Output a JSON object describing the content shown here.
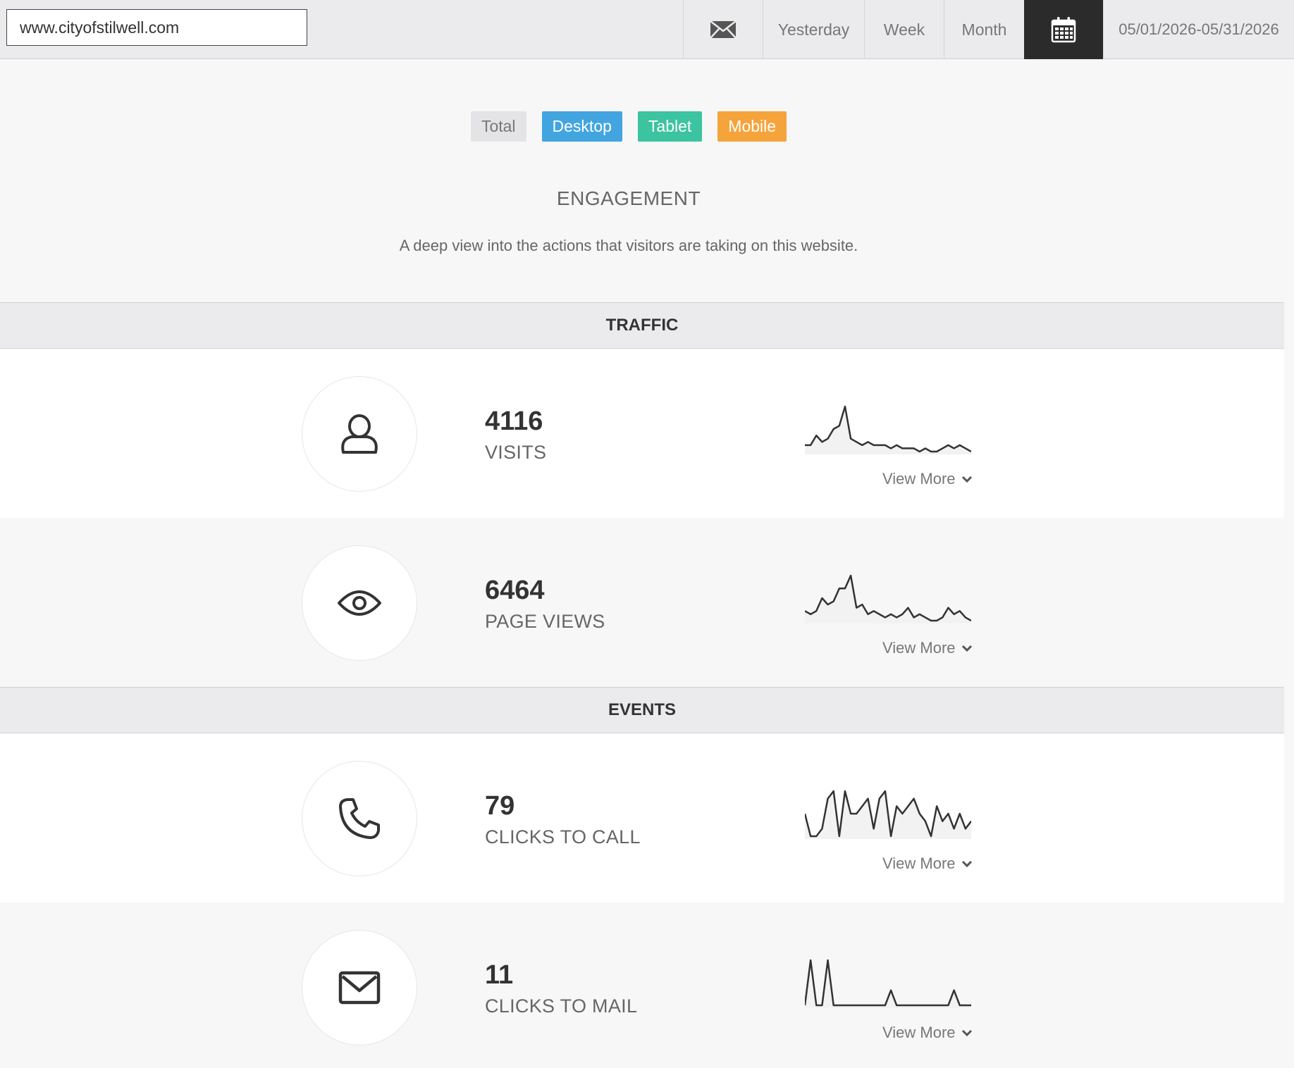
{
  "topbar": {
    "url": "www.cityofstilwell.com",
    "icons": {
      "mail": "envelope-icon",
      "calendar": "calendar-icon"
    },
    "periods": [
      "Yesterday",
      "Week",
      "Month"
    ],
    "date_range": "05/01/2026-05/31/2026"
  },
  "filters": [
    {
      "label": "Total",
      "color": "#e4e4e6"
    },
    {
      "label": "Desktop",
      "color": "#42a5e0"
    },
    {
      "label": "Tablet",
      "color": "#3cc3a0"
    },
    {
      "label": "Mobile",
      "color": "#f5a43c"
    }
  ],
  "header": {
    "title": "ENGAGEMENT",
    "subtitle": "A deep view into the actions that visitors are taking on this website."
  },
  "sections": {
    "traffic": "TRAFFIC",
    "events": "EVENTS"
  },
  "view_more_label": "View More",
  "metrics": [
    {
      "value": "4116",
      "label": "VISITS",
      "icon": "user-icon",
      "chart_data": {
        "type": "line",
        "values": [
          3,
          3,
          6,
          4,
          5,
          8,
          9,
          15,
          5,
          4,
          3,
          4,
          3,
          3,
          3,
          2,
          3,
          2,
          2,
          2,
          1,
          2,
          1,
          1,
          2,
          3,
          2,
          3,
          2,
          1
        ]
      }
    },
    {
      "value": "6464",
      "label": "PAGE VIEWS",
      "icon": "eye-icon",
      "chart_data": {
        "type": "line",
        "values": [
          5,
          4,
          5,
          9,
          7,
          8,
          12,
          12,
          16,
          6,
          7,
          4,
          5,
          4,
          3,
          4,
          3,
          4,
          6,
          3,
          4,
          3,
          2,
          2,
          3,
          6,
          4,
          5,
          3,
          2
        ]
      }
    },
    {
      "value": "79",
      "label": "CLICKS TO CALL",
      "icon": "phone-icon",
      "chart_data": {
        "type": "line",
        "values": [
          4,
          1,
          1,
          2,
          6,
          7,
          1,
          7,
          4,
          4,
          5,
          6,
          2,
          6,
          7,
          1,
          5,
          4,
          5,
          6,
          4,
          3,
          1,
          5,
          3,
          4,
          2,
          4,
          2,
          3
        ]
      }
    },
    {
      "value": "11",
      "label": "CLICKS TO MAIL",
      "icon": "envelope-icon",
      "chart_data": {
        "type": "line",
        "values": [
          0,
          3,
          0,
          0,
          3,
          0,
          0,
          0,
          0,
          0,
          0,
          0,
          0,
          0,
          0,
          1,
          0,
          0,
          0,
          0,
          0,
          0,
          0,
          0,
          0,
          0,
          1,
          0,
          0,
          0
        ]
      }
    }
  ]
}
